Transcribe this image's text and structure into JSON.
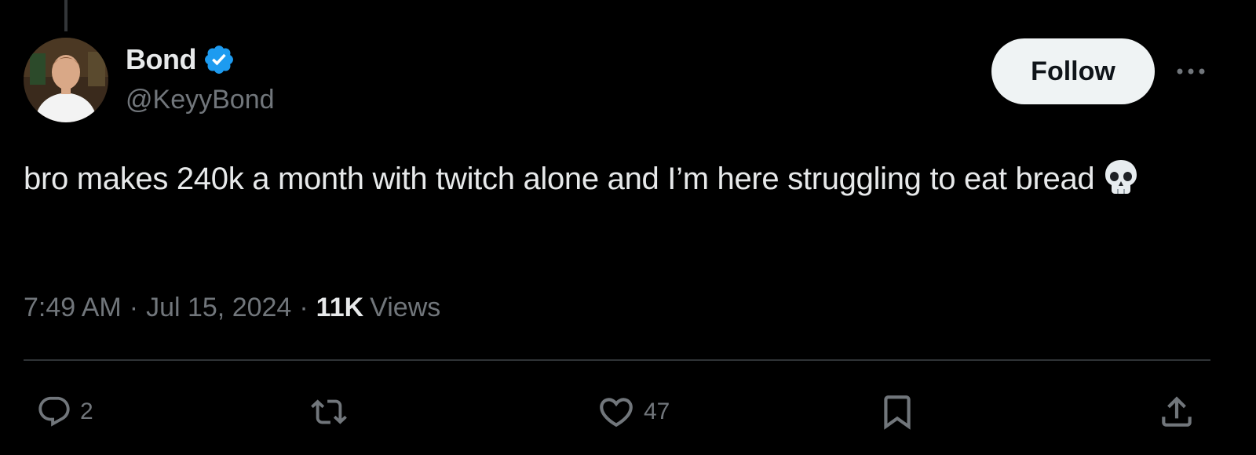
{
  "tweet": {
    "author": {
      "display_name": "Bond",
      "handle": "@KeyyBond",
      "verified": true,
      "verified_color": "#1d9bf0"
    },
    "follow_label": "Follow",
    "text_main": "bro makes 240k a month with twitch alone and I’m here struggling to eat bread",
    "emoji": "skull",
    "time": "7:49 AM",
    "date": "Jul 15, 2024",
    "separator": "·",
    "views_count": "11K",
    "views_label": "Views",
    "actions": {
      "reply_count": "2",
      "retweet_count": "",
      "like_count": "47"
    }
  },
  "icons": {
    "more": "more-horizontal-icon",
    "reply": "reply-icon",
    "retweet": "retweet-icon",
    "like": "heart-icon",
    "bookmark": "bookmark-icon",
    "share": "share-icon"
  },
  "colors": {
    "background": "#000000",
    "text_primary": "#e7e9ea",
    "text_secondary": "#71767b",
    "follow_bg": "#eff3f4",
    "divider": "#2f3336"
  }
}
